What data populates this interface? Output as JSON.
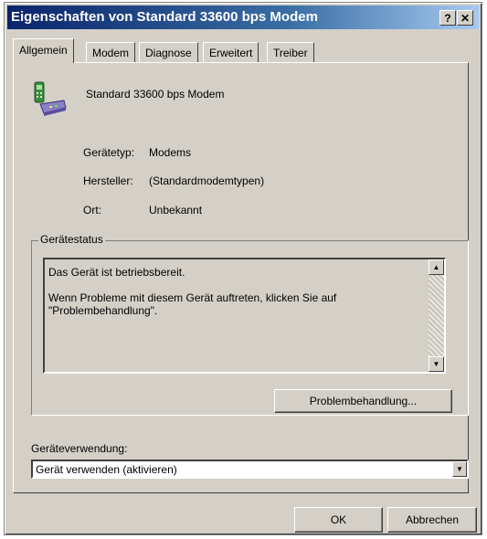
{
  "window": {
    "title": "Eigenschaften von Standard 33600 bps Modem",
    "help_label": "?",
    "close_label": "✕"
  },
  "tabs": [
    {
      "label": "Allgemein",
      "active": true
    },
    {
      "label": "Modem",
      "active": false
    },
    {
      "label": "Diagnose",
      "active": false
    },
    {
      "label": "Erweitert",
      "active": false
    },
    {
      "label": "Treiber",
      "active": false
    }
  ],
  "device": {
    "icon": "modem-icon",
    "name": "Standard 33600 bps Modem"
  },
  "properties": [
    {
      "label": "Gerätetyp:",
      "value": "Modems"
    },
    {
      "label": "Hersteller:",
      "value": "(Standardmodemtypen)"
    },
    {
      "label": "Ort:",
      "value": "Unbekannt"
    }
  ],
  "status": {
    "group_title": "Gerätestatus",
    "line1": "Das Gerät ist betriebsbereit.",
    "line2": "Wenn Probleme mit diesem Gerät auftreten, klicken Sie auf \"Problembehandlung\".",
    "troubleshoot_label": "Problembehandlung..."
  },
  "usage": {
    "label": "Geräteverwendung:",
    "selected": "Gerät verwenden (aktivieren)"
  },
  "footer": {
    "ok_label": "OK",
    "cancel_label": "Abbrechen"
  },
  "colors": {
    "dialog_face": "#d4d0c8",
    "title_start": "#0a246a",
    "title_end": "#a6caf0"
  }
}
